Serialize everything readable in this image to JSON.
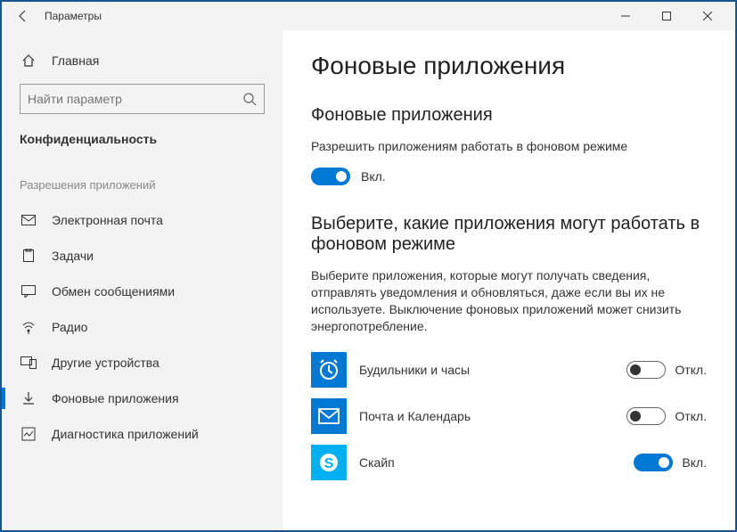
{
  "window": {
    "title": "Параметры"
  },
  "sidebar": {
    "home": "Главная",
    "search_placeholder": "Найти параметр",
    "section": "Конфиденциальность",
    "group": "Разрешения приложений",
    "items": [
      {
        "label": "Электронная почта"
      },
      {
        "label": "Задачи"
      },
      {
        "label": "Обмен сообщениями"
      },
      {
        "label": "Радио"
      },
      {
        "label": "Другие устройства"
      },
      {
        "label": "Фоновые приложения"
      },
      {
        "label": "Диагностика приложений"
      }
    ]
  },
  "main": {
    "title": "Фоновые приложения",
    "section1_title": "Фоновые приложения",
    "section1_desc": "Разрешить приложениям работать в фоновом режиме",
    "master_toggle": {
      "on": true,
      "label": "Вкл."
    },
    "section2_title": "Выберите, какие приложения могут работать в фоновом режиме",
    "section2_desc": "Выберите приложения, которые могут получать сведения, отправлять уведомления и обновляться, даже если вы их не используете. Выключение фоновых приложений может снизить энергопотребление.",
    "apps": [
      {
        "name": "Будильники и часы",
        "on": false,
        "state": "Откл."
      },
      {
        "name": "Почта и Календарь",
        "on": false,
        "state": "Откл."
      },
      {
        "name": "Скайп",
        "on": true,
        "state": "Вкл."
      }
    ]
  }
}
